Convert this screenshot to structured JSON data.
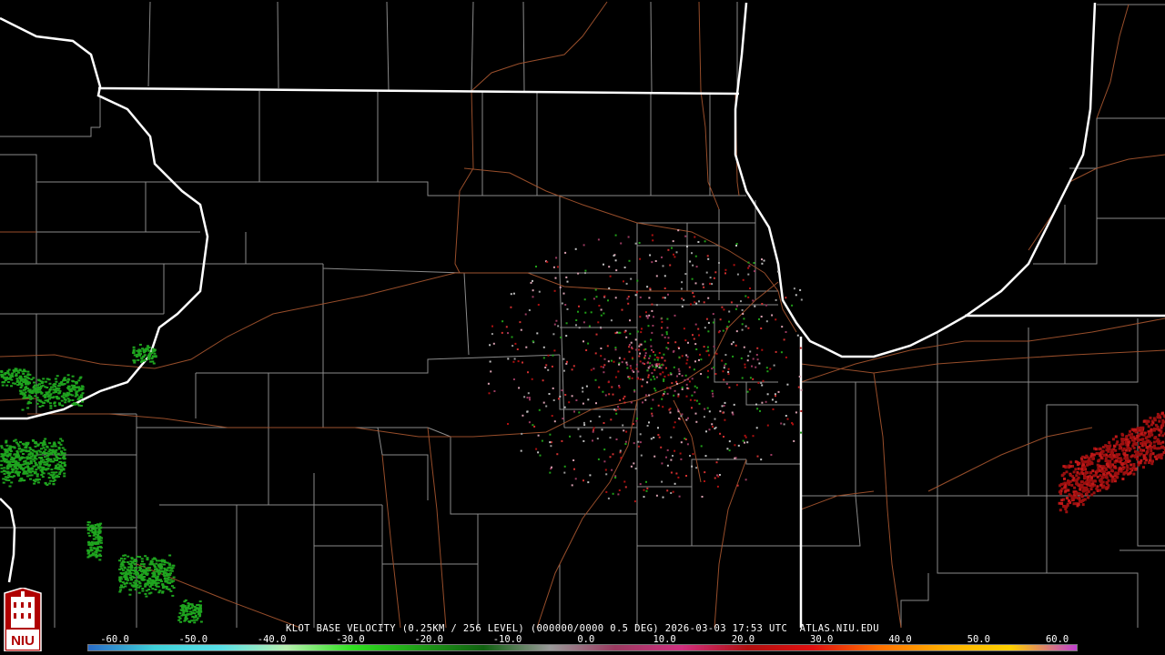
{
  "product": {
    "caption": "KLOT BASE VELOCITY (0.25KM / 256 LEVEL) (000000/0000 0.5 DEG) 2026-03-03 17:53 UTC  ATLAS.NIU.EDU"
  },
  "logo": {
    "text": "NIU",
    "icon": "niu-building-icon"
  },
  "colorbar": {
    "labels": [
      "-60.0",
      "-50.0",
      "-40.0",
      "-30.0",
      "-20.0",
      "-10.0",
      "0.0",
      "10.0",
      "20.0",
      "30.0",
      "40.0",
      "50.0",
      "60.0"
    ],
    "stops": [
      "#2a6cc8",
      "#3fd0d8",
      "#58e0e8",
      "#b8f0b0",
      "#30e020",
      "#20a018",
      "#106010",
      "#9a9a9a",
      "#9a3a60",
      "#d03080",
      "#b01010",
      "#e01010",
      "#ff7000",
      "#ffb000",
      "#ffd000",
      "#c040d0"
    ]
  },
  "colors": {
    "state_border": "#ffffff",
    "county_border": "#8a8a8a",
    "highway": "#a0522d",
    "inbound_echo": "#1fa51f",
    "outbound_echo": "#9b0f0f"
  }
}
